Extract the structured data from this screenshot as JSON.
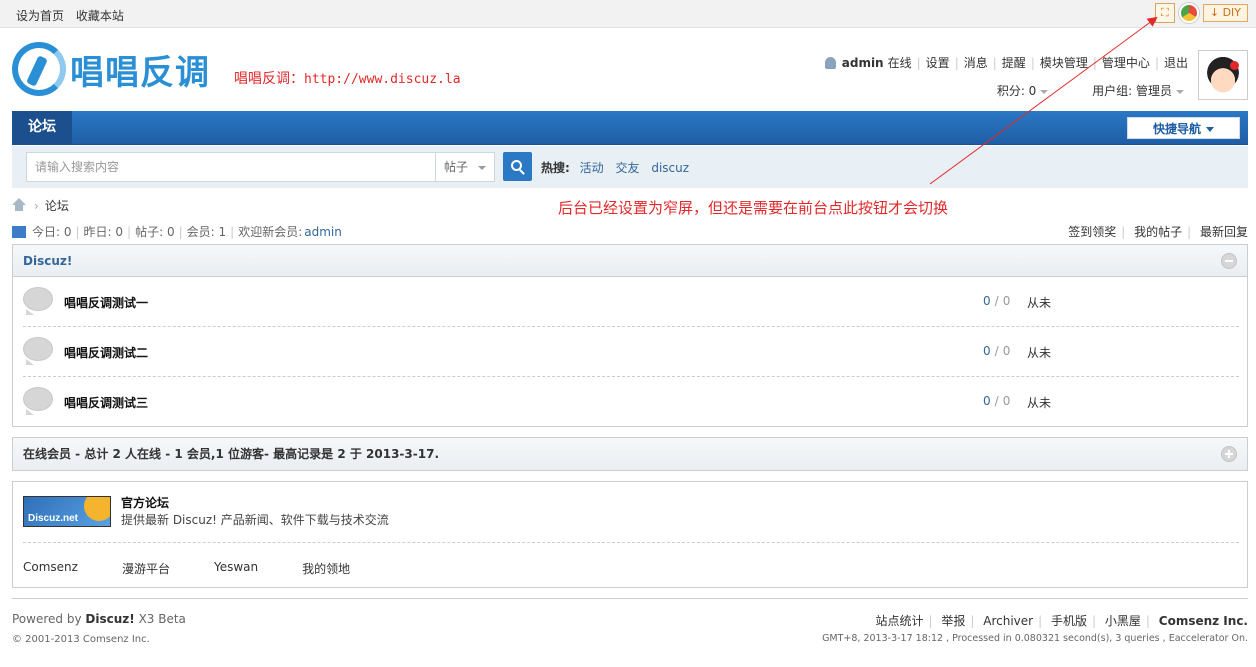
{
  "topbar": {
    "links": [
      "设为首页",
      "收藏本站"
    ],
    "diy_label": "DIY"
  },
  "logo": {
    "text": "唱唱反调"
  },
  "site_note": {
    "label": "唱唱反调：",
    "url": "http://www.discuz.la"
  },
  "user": {
    "name": "admin",
    "status": "在线",
    "menu": [
      "设置",
      "消息",
      "提醒",
      "模块管理",
      "管理中心",
      "退出"
    ],
    "points": "积分: 0",
    "group": "用户组: 管理员"
  },
  "nav": {
    "tab": "论坛",
    "quicknav": "快捷导航"
  },
  "search": {
    "placeholder": "请输入搜索内容",
    "type": "帖子",
    "hot_label": "热搜:",
    "hot_terms": [
      "活动",
      "交友",
      "discuz"
    ]
  },
  "breadcrumb": {
    "current": "论坛"
  },
  "annotation": "后台已经设置为窄屏，但还是需要在前台点此按钮才会切换",
  "stats": {
    "today": "今日: 0",
    "yesterday": "昨日: 0",
    "posts": "帖子: 0",
    "members": "会员: 1",
    "welcome": "欢迎新会员:",
    "newest_member": "admin"
  },
  "quicklinks": [
    "签到领奖",
    "我的帖子",
    "最新回复"
  ],
  "category": {
    "title": "Discuz!",
    "forums": [
      {
        "name": "唱唱反调测试一",
        "threads": "0",
        "posts": "0",
        "last": "从未"
      },
      {
        "name": "唱唱反调测试二",
        "threads": "0",
        "posts": "0",
        "last": "从未"
      },
      {
        "name": "唱唱反调测试三",
        "threads": "0",
        "posts": "0",
        "last": "从未"
      }
    ]
  },
  "online": {
    "title": "在线会员 - 总计 2 人在线 - 1 会员,1 位游客- 最高记录是 2 于 2013-3-17."
  },
  "friend_links": {
    "logo_text": "Discuz.net",
    "official_title": "官方论坛",
    "official_desc": "提供最新 Discuz! 产品新闻、软件下载与技术交流",
    "text_links": [
      "Comsenz",
      "漫游平台",
      "Yeswan",
      "我的领地"
    ]
  },
  "footer": {
    "powered_prefix": "Powered by",
    "powered_brand": "Discuz!",
    "powered_version": "X3 Beta",
    "copyright": "© 2001-2013 Comsenz Inc.",
    "links": [
      "站点统计",
      "举报",
      "Archiver",
      "手机版",
      "小黑屋"
    ],
    "brand": "Comsenz Inc.",
    "gmt": "GMT+8, 2013-3-17 18:12 , Processed in 0.080321 second(s), 3 queries , Eaccelerator On."
  },
  "colors": {
    "accent": "#2b78c4",
    "annotation": "#e3282a",
    "link": "#336699"
  }
}
